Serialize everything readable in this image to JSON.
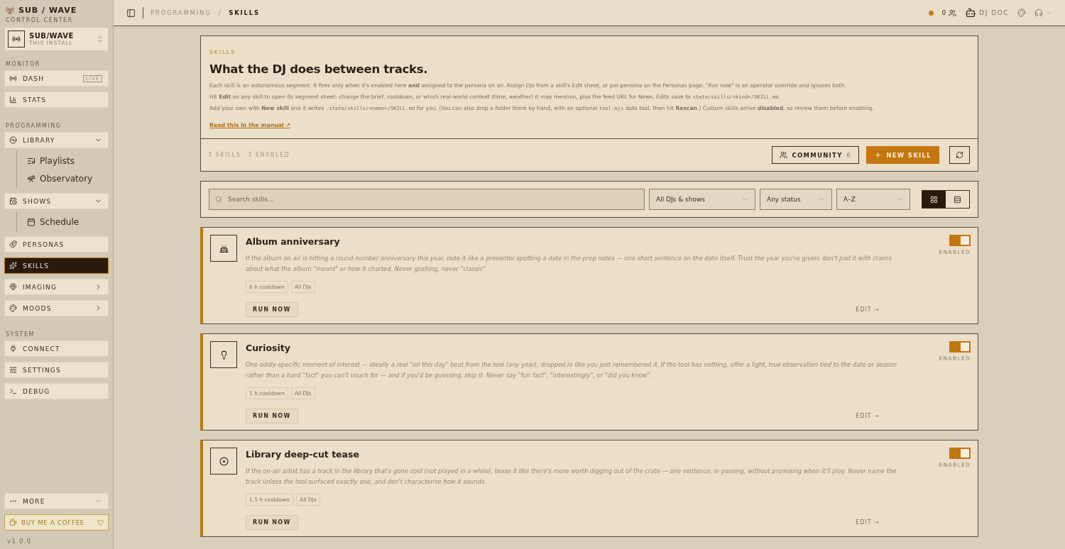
{
  "sidebar": {
    "brand": "SUB / WAVE",
    "subtitle": "CONTROL CENTER",
    "install": {
      "name": "SUB/WAVE",
      "detail": "THIS INSTALL"
    },
    "sections": [
      {
        "label": "MONITOR",
        "items": [
          {
            "label": "DASH",
            "badge": "LIVE",
            "selected": false
          },
          {
            "label": "STATS",
            "selected": false
          }
        ]
      },
      {
        "label": "PROGRAMMING",
        "items": [
          {
            "label": "LIBRARY",
            "selected": false,
            "expanded": true,
            "children": [
              {
                "label": "Playlists",
                "selected": false
              },
              {
                "label": "Observatory",
                "selected": false
              }
            ]
          },
          {
            "label": "SHOWS",
            "selected": false,
            "expanded": true,
            "children": [
              {
                "label": "Schedule",
                "selected": false
              }
            ]
          },
          {
            "label": "PERSONAS",
            "selected": false
          },
          {
            "label": "SKILLS",
            "selected": true
          },
          {
            "label": "IMAGING",
            "selected": false,
            "expanded": false
          },
          {
            "label": "MOODS",
            "selected": false,
            "expanded": false
          }
        ]
      },
      {
        "label": "SYSTEM",
        "items": [
          {
            "label": "CONNECT",
            "selected": false
          },
          {
            "label": "SETTINGS",
            "selected": false
          },
          {
            "label": "DEBUG",
            "selected": false
          }
        ]
      }
    ],
    "more": "MORE",
    "coffee": "BUY ME A COFFEE",
    "version": "v1.0.0"
  },
  "topbar": {
    "breadcrumb": [
      "PROGRAMMING",
      "SKILLS"
    ],
    "separator": "/",
    "listeners": "0",
    "dj": "DJ DOC"
  },
  "hero": {
    "eyebrow": "SKILLS",
    "title": "What the DJ does between tracks.",
    "paragraphs": [
      [
        {
          "kind": "text",
          "text": "Each skill is an autonomous segment. It fires only when it's enabled here **and** assigned to the persona on air. Assign DJs from a skill's Edit sheet, or per-persona on the Personas page. \"Run now\" is an operator override and ignores both."
        }
      ],
      [
        {
          "kind": "text",
          "text": "Hit **Edit** on any skill to open its segment sheet: change the brief, cooldown, or which real-world context (time, weather) it may mention, plus the feed URL for News. Edits save to "
        },
        {
          "kind": "code",
          "text": "state/skills/<kind>/SKILL.md"
        },
        {
          "kind": "text",
          "text": "."
        }
      ],
      [
        {
          "kind": "text",
          "text": "Add your own with **New skill** and it writes "
        },
        {
          "kind": "code",
          "text": ".state/skills/<name>/SKILL.md"
        },
        {
          "kind": "text",
          "text": " for you. (You can also drop a folder there by hand, with an optional "
        },
        {
          "kind": "code",
          "text": "tool.mjs"
        },
        {
          "kind": "text",
          "text": " data tool, then hit **Rescan**.) Custom skills arrive **disabled**, so review them before enabling."
        }
      ]
    ],
    "link": "Read this in the manual ↗",
    "count": "7 SKILLS",
    "enabled_count": "7 ENABLED",
    "community": "COMMUNITY",
    "community_count": "6",
    "new_skill": "NEW SKILL"
  },
  "filters": {
    "search": {
      "placeholder": "Search skills..."
    },
    "selects": [
      "All DJs & shows",
      "Any status",
      "A–Z"
    ],
    "views": [
      {
        "kind": "grid",
        "selected": true
      },
      {
        "kind": "list",
        "selected": false
      }
    ]
  },
  "skills": [
    {
      "title": "Album anniversary",
      "description": "If the album on air is hitting a round-number anniversary this year, note it like a presenter spotting a date in the prep notes — one short sentence on the date itself. Trust the year you're given; don't pad it with claims about what the album \"meant\" or how it charted. Never gushing, never \"classic\".",
      "tags": [
        "6 h cooldown",
        "All DJs"
      ],
      "run": "RUN NOW",
      "edit": "EDIT →",
      "enabled": true,
      "status": "ENABLED"
    },
    {
      "title": "Curiosity",
      "description": "One oddly-specific moment of interest — ideally a real \"on this day\" beat from the tool (any year), dropped in like you just remembered it. If the tool has nothing, offer a light, true observation tied to the date or season rather than a hard \"fact\" you can't vouch for — and if you'd be guessing, skip it. Never say \"fun fact\", \"interestingly\", or \"did you know\".",
      "tags": [
        "1 h cooldown",
        "All DJs"
      ],
      "run": "RUN NOW",
      "edit": "EDIT →",
      "enabled": true,
      "status": "ENABLED"
    },
    {
      "title": "Library deep-cut tease",
      "description": "If the on-air artist has a track in the library that's gone cold (not played in a while), tease it like there's more worth digging out of the crate — one sentence, in passing, without promising when it'll play. Never name the track unless the tool surfaced exactly one, and don't characterise how it sounds.",
      "tags": [
        "1.5 h cooldown",
        "All DJs"
      ],
      "run": "RUN NOW",
      "edit": "EDIT →",
      "enabled": true,
      "status": "ENABLED"
    }
  ]
}
